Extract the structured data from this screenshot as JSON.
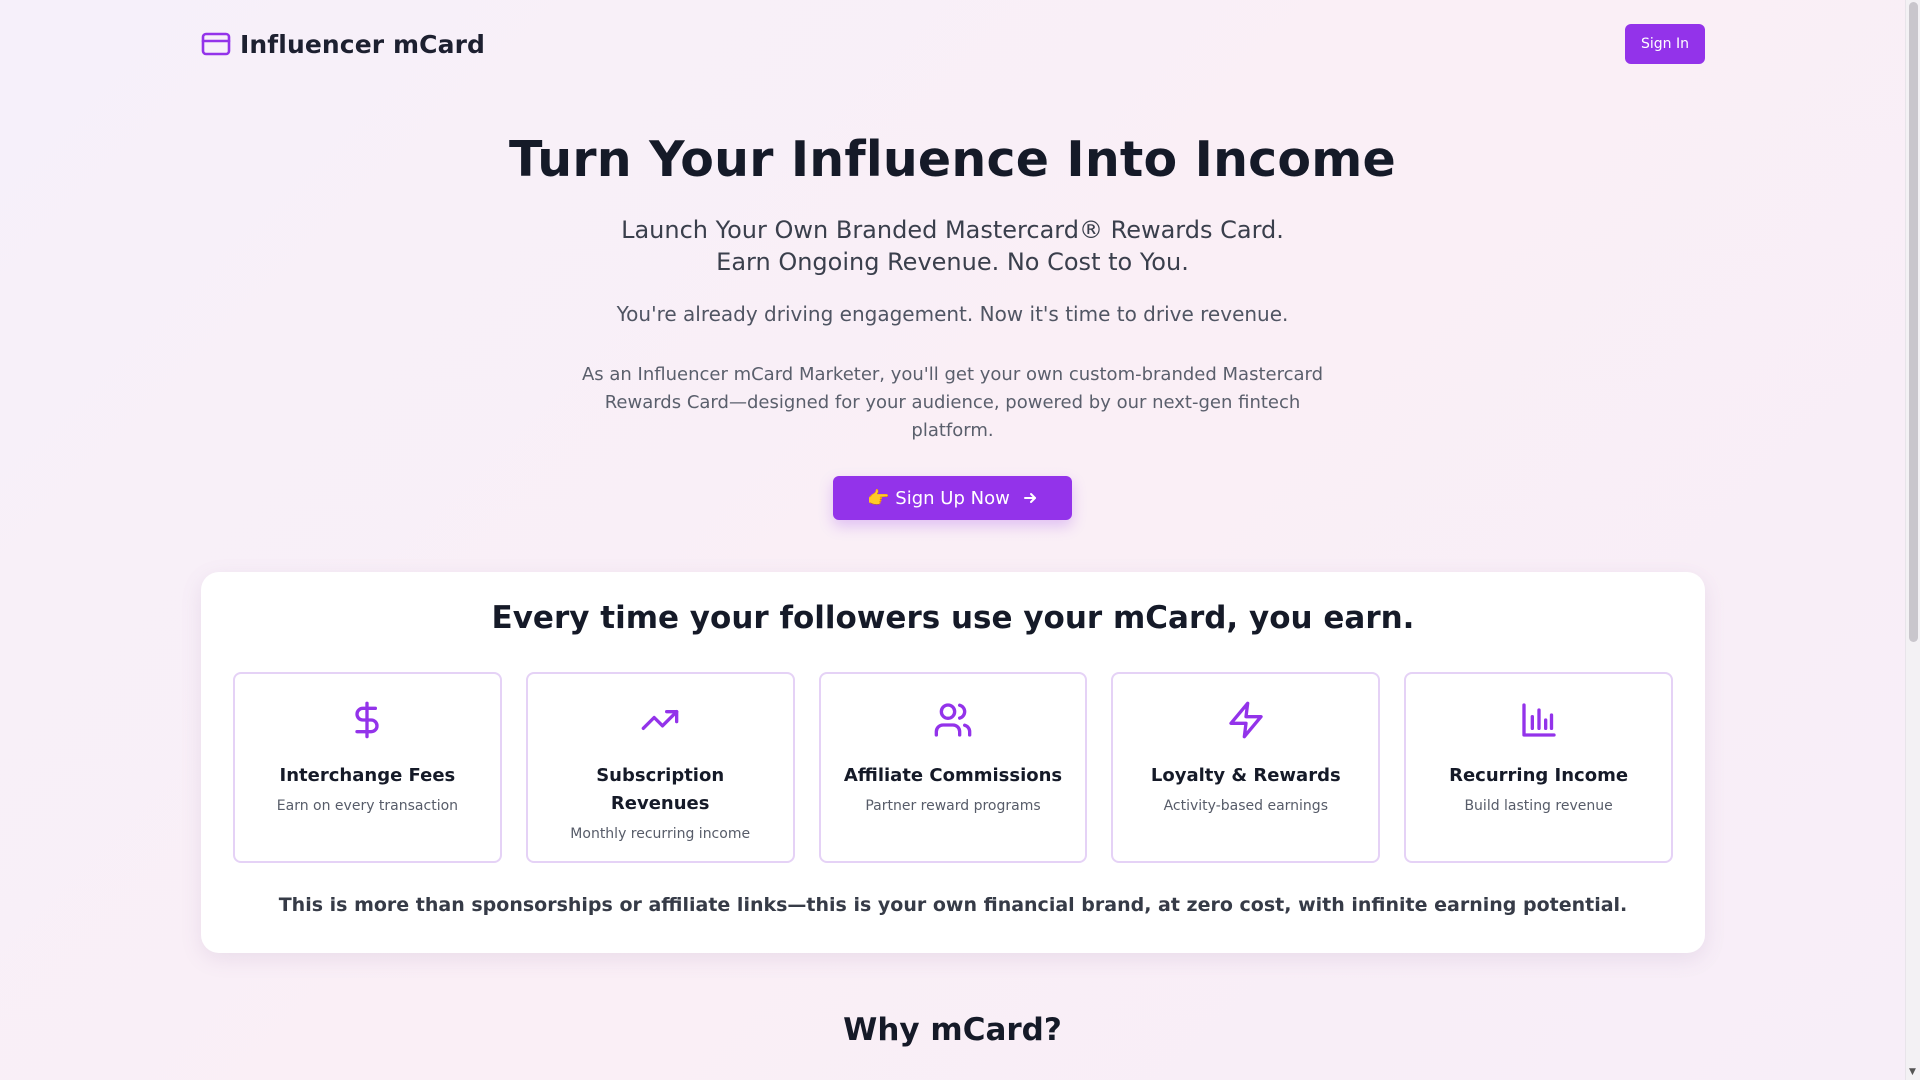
{
  "header": {
    "brand_name": "Influencer mCard",
    "brand_icon": "credit-card-icon",
    "signin_label": "Sign In"
  },
  "hero": {
    "title": "Turn Your Influence Into Income",
    "subtitle_line1": "Launch Your Own Branded Mastercard® Rewards Card.",
    "subtitle_line2": "Earn Ongoing Revenue. No Cost to You.",
    "tagline": "You're already driving engagement. Now it's time to drive revenue.",
    "description": "As an Influencer mCard Marketer, you'll get your own custom-branded Mastercard Rewards Card—designed for your audience, powered by our next-gen fintech platform.",
    "cta_label": "👉 Sign Up Now"
  },
  "earn": {
    "title": "Every time your followers use your mCard, you earn.",
    "cards": [
      {
        "icon": "dollar-icon",
        "title": "Interchange Fees",
        "desc": "Earn on every transaction"
      },
      {
        "icon": "trending-up-icon",
        "title": "Subscription Revenues",
        "desc": "Monthly recurring income"
      },
      {
        "icon": "users-icon",
        "title": "Affiliate Commissions",
        "desc": "Partner reward programs"
      },
      {
        "icon": "lightning-icon",
        "title": "Loyalty & Rewards",
        "desc": "Activity-based earnings"
      },
      {
        "icon": "bar-chart-icon",
        "title": "Recurring Income",
        "desc": "Build lasting revenue"
      }
    ],
    "footer": "This is more than sponsorships or affiliate links—this is your own financial brand, at zero cost, with infinite earning potential."
  },
  "why": {
    "title": "Why mCard?"
  },
  "colors": {
    "accent": "#9333ea",
    "card_border": "#e5d2f6",
    "heading": "#151a28"
  }
}
